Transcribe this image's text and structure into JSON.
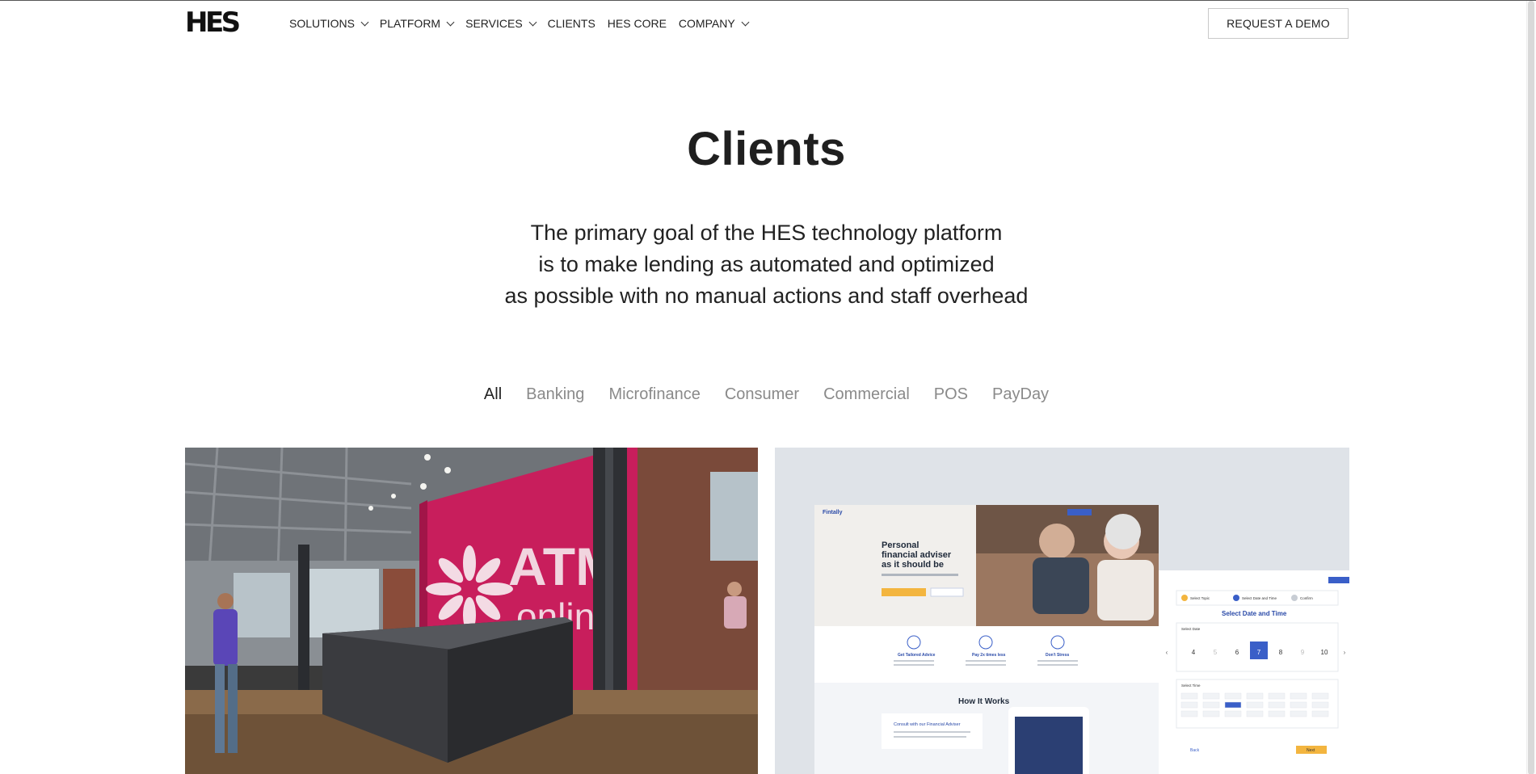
{
  "header": {
    "logo": "HES",
    "nav": [
      {
        "label": "SOLUTIONS",
        "dropdown": true
      },
      {
        "label": "PLATFORM",
        "dropdown": true
      },
      {
        "label": "SERVICES",
        "dropdown": true
      },
      {
        "label": "CLIENTS",
        "dropdown": false
      },
      {
        "label": "HES CORE",
        "dropdown": false
      },
      {
        "label": "COMPANY",
        "dropdown": true
      }
    ],
    "cta": "REQUEST A DEMO"
  },
  "hero": {
    "title": "Clients",
    "subtitle_lines": [
      "The primary goal of the HES technology platform",
      "is to make lending as automated and optimized",
      "as possible with no manual actions and staff overhead"
    ]
  },
  "filters": {
    "items": [
      "All",
      "Banking",
      "Microfinance",
      "Consumer",
      "Commercial",
      "POS",
      "PayDay"
    ],
    "active": "All"
  },
  "cards": [
    {
      "image": "office-reception-photo",
      "wall_brand_line1": "ATM",
      "wall_brand_line2": "online"
    },
    {
      "image": "website-mockup-screenshot",
      "mock": {
        "brand": "Fintally",
        "hero_line1": "Personal",
        "hero_line2": "financial adviser",
        "hero_line3": "as it should be",
        "features": [
          "Get Tailored Advice",
          "Pay 2x times less",
          "Don't Stress"
        ],
        "how_it_works": "How It Works",
        "consult": "Consult with our Financial Adviser",
        "steps": [
          "Select Topic",
          "Select Date and Time",
          "Confirm"
        ],
        "schedule_title": "Select Date and Time",
        "select_date": "Select Date",
        "select_time": "Select Time",
        "dates": [
          "4",
          "5",
          "6",
          "7",
          "8",
          "9",
          "10"
        ],
        "selected_date": "7",
        "back": "Back",
        "next": "Next"
      }
    }
  ],
  "colors": {
    "wall_magenta": "#c81e5c",
    "mock_blue": "#3a5fc8",
    "mock_yellow": "#f3b53f"
  }
}
